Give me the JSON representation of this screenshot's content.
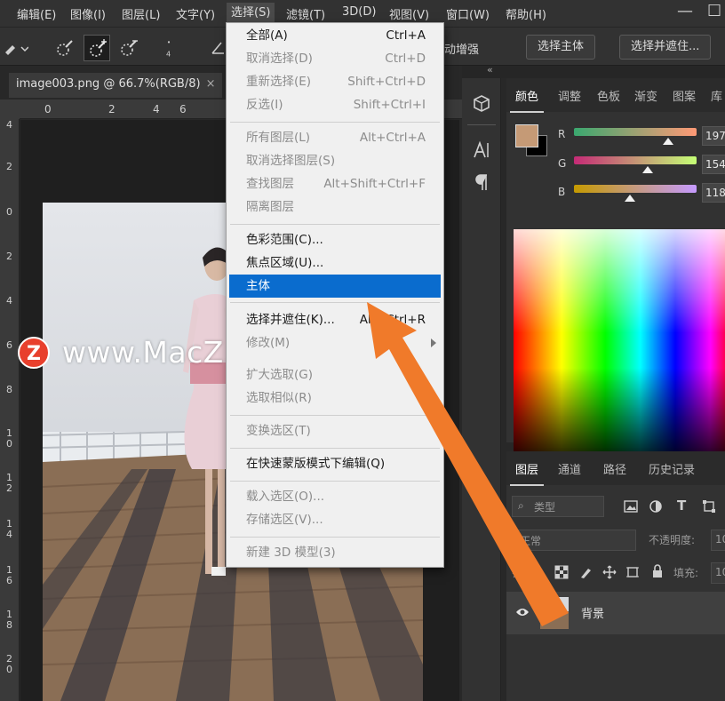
{
  "menubar": {
    "items": [
      "编辑(E)",
      "图像(I)",
      "图层(L)",
      "文字(Y)",
      "选择(S)",
      "滤镜(T)",
      "3D(D)",
      "视图(V)",
      "窗口(W)",
      "帮助(H)"
    ],
    "window_controls": [
      "—",
      "☐"
    ]
  },
  "options_bar": {
    "auto_enhance": "自动增强",
    "select_subject": "选择主体",
    "select_and_mask": "选择并遮住..."
  },
  "document": {
    "tab_title": "image003.png @ 66.7%(RGB/8)",
    "close": "×",
    "h_ruler_ticks": [
      "0",
      "2",
      "4",
      "6"
    ],
    "v_ruler_ticks": [
      "4",
      "2",
      "0",
      "2",
      "4",
      "6",
      "8",
      "1\n0",
      "1\n2",
      "1\n4",
      "1\n6",
      "1\n8",
      "2\n0"
    ]
  },
  "select_menu": {
    "items": [
      {
        "label": "全部(A)",
        "shortcut": "Ctrl+A",
        "enabled": true
      },
      {
        "label": "取消选择(D)",
        "shortcut": "Ctrl+D",
        "enabled": false
      },
      {
        "label": "重新选择(E)",
        "shortcut": "Shift+Ctrl+D",
        "enabled": false
      },
      {
        "label": "反选(I)",
        "shortcut": "Shift+Ctrl+I",
        "enabled": false
      },
      {
        "label": "所有图层(L)",
        "shortcut": "Alt+Ctrl+A",
        "enabled": false
      },
      {
        "label": "取消选择图层(S)",
        "shortcut": "",
        "enabled": false
      },
      {
        "label": "查找图层",
        "shortcut": "Alt+Shift+Ctrl+F",
        "enabled": false
      },
      {
        "label": "隔离图层",
        "shortcut": "",
        "enabled": false
      },
      {
        "label": "色彩范围(C)...",
        "shortcut": "",
        "enabled": true
      },
      {
        "label": "焦点区域(U)...",
        "shortcut": "",
        "enabled": true
      },
      {
        "label": "主体",
        "shortcut": "",
        "enabled": true,
        "highlighted": true
      },
      {
        "label": "选择并遮住(K)...",
        "shortcut": "Alt+Ctrl+R",
        "enabled": true
      },
      {
        "label": "修改(M)",
        "shortcut": "",
        "enabled": false,
        "submenu": true
      },
      {
        "label": "扩大选取(G)",
        "shortcut": "",
        "enabled": false
      },
      {
        "label": "选取相似(R)",
        "shortcut": "",
        "enabled": false
      },
      {
        "label": "变换选区(T)",
        "shortcut": "",
        "enabled": false
      },
      {
        "label": "在快速蒙版模式下编辑(Q)",
        "shortcut": "",
        "enabled": true
      },
      {
        "label": "载入选区(O)...",
        "shortcut": "",
        "enabled": false
      },
      {
        "label": "存储选区(V)...",
        "shortcut": "",
        "enabled": false
      },
      {
        "label": "新建 3D 模型(3)",
        "shortcut": "",
        "enabled": false
      }
    ]
  },
  "color_panel": {
    "tabs": [
      "颜色",
      "调整",
      "色板",
      "渐变",
      "图案",
      "库"
    ],
    "channels": [
      {
        "name": "R",
        "value": "197",
        "fraction": 0.77
      },
      {
        "name": "G",
        "value": "154",
        "fraction": 0.6
      },
      {
        "name": "B",
        "value": "118",
        "fraction": 0.46
      }
    ],
    "foreground_color": "#c59a76",
    "background_color": "#000000"
  },
  "layers_panel": {
    "tabs": [
      "图层",
      "通道",
      "路径",
      "历史记录"
    ],
    "filter_label": "类型",
    "blend_mode": "正常",
    "opacity_label": "不透明度:",
    "opacity_value": "10",
    "lock_label": "锁定:",
    "fill_label": "填充:",
    "fill_value": "10",
    "layer_name": "背景"
  },
  "watermark": {
    "logo": "Z",
    "text": "www.MacZ.com"
  },
  "accent_color": "#0a6cce",
  "arrow_color": "#f07a2a"
}
